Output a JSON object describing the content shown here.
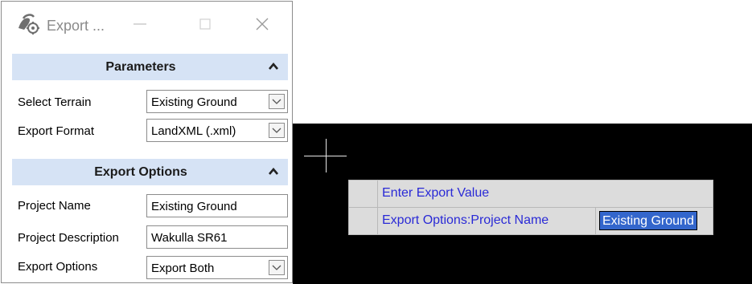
{
  "dialog": {
    "title": "Export ...",
    "icons": {
      "app": "terrain-export-icon",
      "minimize": "minimize-icon",
      "maximize": "maximize-icon",
      "close": "close-icon"
    }
  },
  "parameters": {
    "header": "Parameters",
    "rows": [
      {
        "label": "Select Terrain",
        "value": "Existing Ground"
      },
      {
        "label": "Export Format",
        "value": "LandXML (.xml)"
      }
    ]
  },
  "export_options": {
    "header": "Export Options",
    "rows": [
      {
        "label": "Project Name",
        "value": "Existing Ground"
      },
      {
        "label": "Project Description",
        "value": "Wakulla SR61"
      },
      {
        "label": "Export Options",
        "value": "Export Both"
      }
    ]
  },
  "prompt": {
    "title": "Enter Export Value",
    "field_label": "Export Options:Project Name",
    "field_value": "Existing Ground"
  },
  "colors": {
    "section_header": "#d6e3f5",
    "prompt_text": "#2a2ad6",
    "selection": "#3366cc",
    "canvas": "#000000"
  }
}
